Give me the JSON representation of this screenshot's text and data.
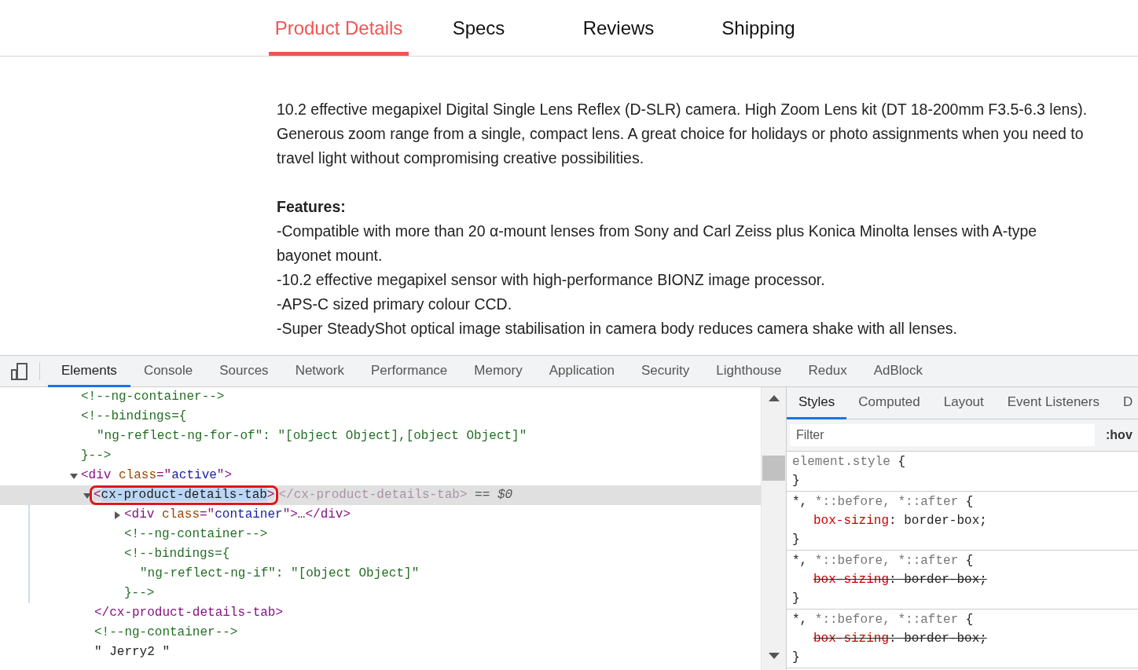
{
  "product_tabs": [
    {
      "label": "Product Details",
      "selected": true
    },
    {
      "label": "Specs",
      "selected": false
    },
    {
      "label": "Reviews",
      "selected": false
    },
    {
      "label": "Shipping",
      "selected": false
    }
  ],
  "description": {
    "intro_lines": [
      "10.2 effective megapixel Digital Single Lens Reflex (D-SLR) camera. High Zoom Lens kit (DT 18-200mm F3.5-6.3 lens).",
      "Generous zoom range from a single, compact lens. A great choice for holidays or photo assignments when you need to",
      "travel light without compromising creative possibilities."
    ],
    "features_heading": "Features:",
    "feature_lines": [
      "-Compatible with more than 20 α-mount lenses from Sony and Carl Zeiss plus Konica Minolta lenses with A-type",
      "bayonet mount.",
      "-10.2 effective megapixel sensor with high-performance BIONZ image processor.",
      "-APS-C sized primary colour CCD.",
      "-Super SteadyShot optical image stabilisation in camera body reduces camera shake with all lenses."
    ]
  },
  "devtools": {
    "tabs": [
      {
        "label": "Elements",
        "selected": true
      },
      {
        "label": "Console",
        "selected": false
      },
      {
        "label": "Sources",
        "selected": false
      },
      {
        "label": "Network",
        "selected": false
      },
      {
        "label": "Performance",
        "selected": false
      },
      {
        "label": "Memory",
        "selected": false
      },
      {
        "label": "Application",
        "selected": false
      },
      {
        "label": "Security",
        "selected": false
      },
      {
        "label": "Lighthouse",
        "selected": false
      },
      {
        "label": "Redux",
        "selected": false
      },
      {
        "label": "AdBlock",
        "selected": false
      }
    ],
    "dom_tree": [
      {
        "kind": "comment",
        "lines": [
          "<!--ng-container-->"
        ]
      },
      {
        "kind": "comment",
        "lines": [
          "<!--bindings={",
          "\"ng-reflect-ng-for-of\": \"[object Object],[object Object]\"",
          "}-->"
        ]
      },
      {
        "kind": "element",
        "expanded": true,
        "selected": false,
        "open": [
          {
            "kind": "tag",
            "text": "<div"
          },
          {
            "kind": "attr",
            "text": " class"
          },
          {
            "kind": "tag",
            "text": "=\""
          },
          {
            "kind": "value",
            "text": "active"
          },
          {
            "kind": "tag",
            "text": "\">"
          }
        ],
        "children": [
          {
            "kind": "element",
            "expanded": true,
            "selected": true,
            "open": [
              {
                "kind": "tag",
                "text": "<"
              },
              {
                "kind": "name",
                "text": "cx-product-details-tab"
              },
              {
                "kind": "tag",
                "text": ">"
              }
            ],
            "trailing": "</cx-product-details-tab>",
            "console_ref": "== $0",
            "children": [
              {
                "kind": "element",
                "expanded": false,
                "selected": false,
                "open": [
                  {
                    "kind": "tag",
                    "text": "<div"
                  },
                  {
                    "kind": "attr",
                    "text": " class"
                  },
                  {
                    "kind": "tag",
                    "text": "=\""
                  },
                  {
                    "kind": "value",
                    "text": "container"
                  },
                  {
                    "kind": "tag",
                    "text": "\">"
                  },
                  {
                    "kind": "plain",
                    "text": "…"
                  },
                  {
                    "kind": "tag",
                    "text": "</div>"
                  }
                ]
              },
              {
                "kind": "comment",
                "lines": [
                  "<!--ng-container-->"
                ]
              },
              {
                "kind": "comment",
                "lines": [
                  "<!--bindings={",
                  "\"ng-reflect-ng-if\": \"[object Object]\"",
                  "}-->"
                ]
              }
            ],
            "close": "</cx-product-details-tab>"
          },
          {
            "kind": "comment",
            "lines": [
              "<!--ng-container-->"
            ]
          },
          {
            "kind": "text",
            "lines": [
              "\" Jerry2 \""
            ]
          }
        ]
      }
    ],
    "side_tabs": [
      {
        "label": "Styles",
        "selected": true
      },
      {
        "label": "Computed",
        "selected": false
      },
      {
        "label": "Layout",
        "selected": false
      },
      {
        "label": "Event Listeners",
        "selected": false
      },
      {
        "label": "D",
        "selected": false
      }
    ],
    "filter": {
      "placeholder": "Filter"
    },
    "hov_button": ":hov",
    "rules": [
      {
        "selector": [
          {
            "text": "element.style",
            "dim": true
          },
          {
            "text": "{",
            "dim": false
          }
        ],
        "close": "}"
      },
      {
        "selector": [
          {
            "text": "*,",
            "dim": false
          },
          {
            "text": "*::before, *::after",
            "dim": true
          },
          {
            "text": "{",
            "dim": false
          }
        ],
        "declarations": [
          {
            "prop": "box-sizing",
            "sep": ":",
            "value": "border-box;",
            "overridden": false
          }
        ],
        "close": "}"
      },
      {
        "selector": [
          {
            "text": "*,",
            "dim": false
          },
          {
            "text": "*::before, *::after",
            "dim": true
          },
          {
            "text": "{",
            "dim": false
          }
        ],
        "declarations": [
          {
            "prop": "box-sizing",
            "sep": ":",
            "value": "border-box;",
            "overridden": true
          }
        ],
        "close": "}"
      },
      {
        "selector": [
          {
            "text": "*,",
            "dim": false
          },
          {
            "text": "*::before, *::after",
            "dim": true
          },
          {
            "text": "{",
            "dim": false
          }
        ],
        "declarations": [
          {
            "prop": "box-sizing",
            "sep": ":",
            "value": "border-box;",
            "overridden": true
          }
        ],
        "close": "}"
      }
    ]
  }
}
